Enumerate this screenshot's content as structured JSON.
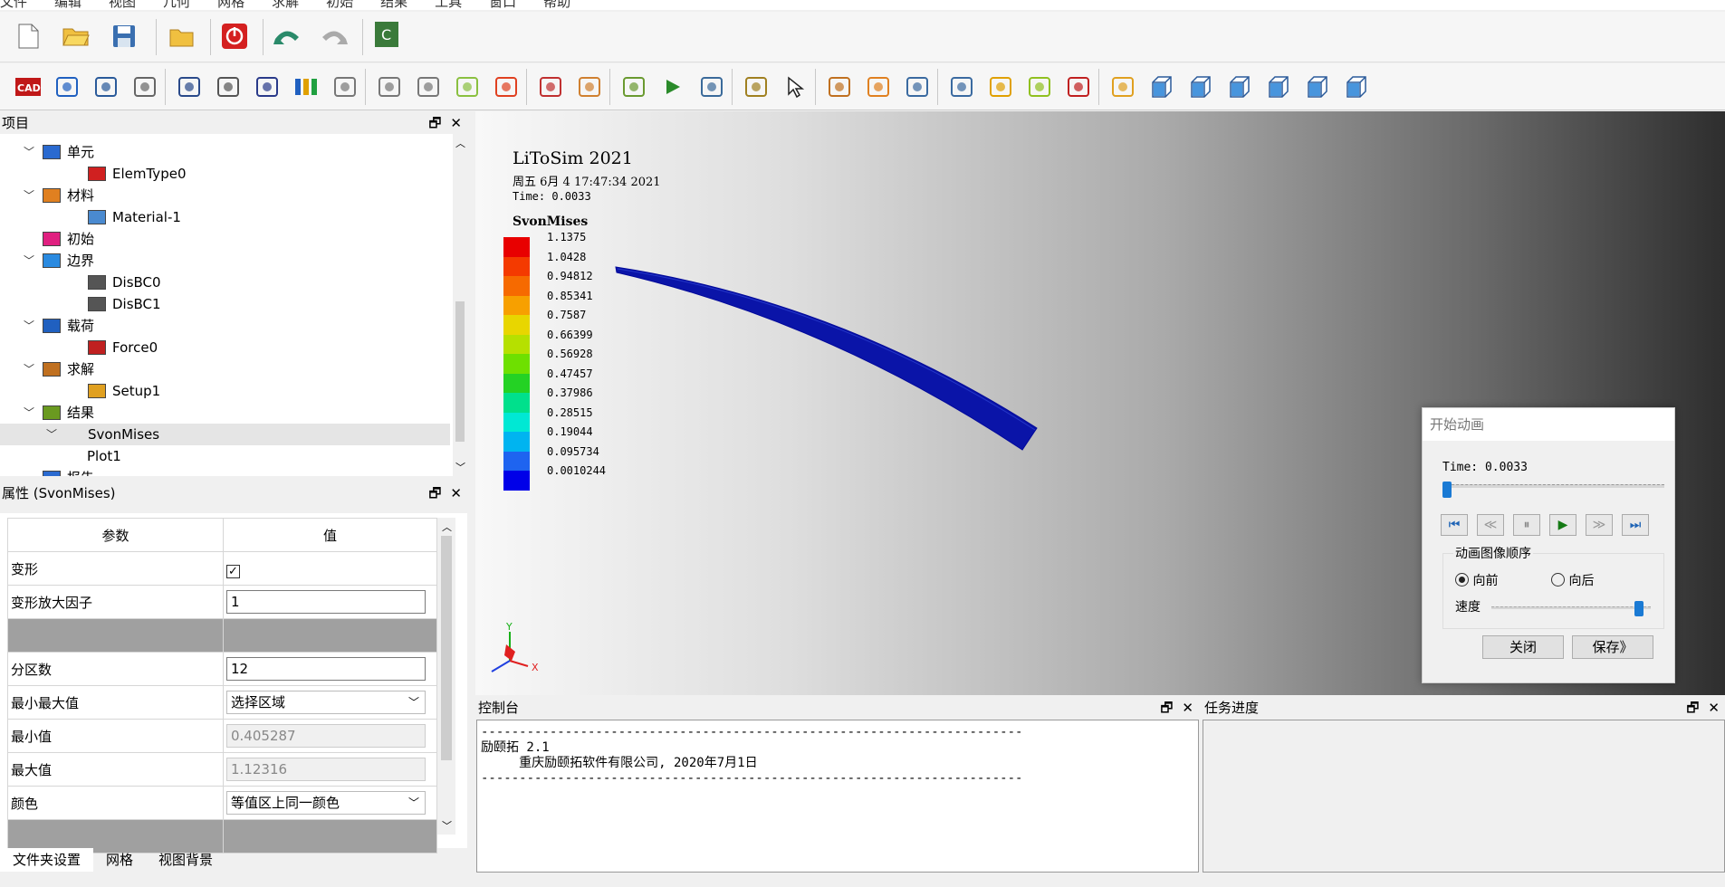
{
  "menu": [
    "文件",
    "编辑",
    "视图",
    "几何",
    "网格",
    "求解",
    "初始",
    "结果",
    "工具",
    "窗口",
    "帮助"
  ],
  "toolbar1": [
    "new-file-icon",
    "open-folder-icon",
    "save-icon",
    "import-icon",
    "power-icon",
    "undo-icon",
    "redo-icon",
    "script-icon"
  ],
  "toolbar2": [
    "cad-import-icon",
    "blocks-icon",
    "box-icon",
    "cylinder-icon",
    "sphere-icon",
    "cone-icon",
    "torus-icon",
    "color-bars-icon",
    "face-icon",
    "extrude-icon",
    "sweep-icon",
    "mesh-cube-icon",
    "mesh-red-cube-icon",
    "mesh-delete-icon",
    "geology-icon",
    "curve-icon",
    "run-icon",
    "zoom-grid-icon",
    "chart-icon",
    "pointer-icon",
    "rotate-icon",
    "pick-icon",
    "zoom-window-icon",
    "zoom-in-icon",
    "add-icon",
    "plus-ball-icon",
    "color-map-icon",
    "bar-chart-icon",
    "view-front-icon",
    "view-back-icon",
    "view-left-icon",
    "view-right-icon",
    "view-top-icon",
    "view-bottom-icon"
  ],
  "project_panel": {
    "title": "项目"
  },
  "tree": [
    {
      "label": "单元",
      "level": 0,
      "arrow": true,
      "icon": "element-icon"
    },
    {
      "label": "ElemType0",
      "level": 1,
      "arrow": false,
      "icon": "elemtype-icon"
    },
    {
      "label": "材料",
      "level": 0,
      "arrow": true,
      "icon": "material-icon"
    },
    {
      "label": "Material-1",
      "level": 1,
      "arrow": false,
      "icon": "material-item-icon"
    },
    {
      "label": "初始",
      "level": 0,
      "arrow": false,
      "icon": "initial-icon"
    },
    {
      "label": "边界",
      "level": 0,
      "arrow": true,
      "icon": "boundary-icon"
    },
    {
      "label": "DisBC0",
      "level": 1,
      "arrow": false,
      "icon": "disbc-icon"
    },
    {
      "label": "DisBC1",
      "level": 1,
      "arrow": false,
      "icon": "disbc-icon"
    },
    {
      "label": "载荷",
      "level": 0,
      "arrow": true,
      "icon": "load-icon"
    },
    {
      "label": "Force0",
      "level": 1,
      "arrow": false,
      "icon": "force-icon"
    },
    {
      "label": "求解",
      "level": 0,
      "arrow": true,
      "icon": "solve-icon"
    },
    {
      "label": "Setup1",
      "level": 1,
      "arrow": false,
      "icon": "setup-icon"
    },
    {
      "label": "结果",
      "level": 0,
      "arrow": true,
      "icon": "result-icon"
    },
    {
      "label": "SvonMises",
      "level": 1,
      "arrow": true,
      "icon": "",
      "selected": true
    },
    {
      "label": "Plot1",
      "level": 2,
      "arrow": false,
      "icon": ""
    },
    {
      "label": "报告",
      "level": 0,
      "arrow": false,
      "icon": "report-icon"
    }
  ],
  "props_panel": {
    "title": "属性 (SvonMises)"
  },
  "props": {
    "header_param": "参数",
    "header_value": "值",
    "deform_label": "变形",
    "deform_checked": "✓",
    "factor_label": "变形放大因子",
    "factor_value": "1",
    "divisions_label": "分区数",
    "divisions_value": "12",
    "minmax_label": "最小最大值",
    "minmax_value": "选择区域",
    "min_label": "最小值",
    "min_value": "0.405287",
    "max_label": "最大值",
    "max_value": "1.12316",
    "color_label": "颜色",
    "color_value": "等值区上同一颜色"
  },
  "bottom_tabs": [
    "文件夹设置",
    "网格",
    "视图背景"
  ],
  "viewport": {
    "app_title": "LiToSim 2021",
    "datetime": "周五 6月 4 17:47:34 2021",
    "time_label": "Time:  0.0033",
    "legend_title": "SvonMises",
    "legend_values": [
      "1.1375",
      "1.0428",
      "0.94812",
      "0.85341",
      "0.7587",
      "0.66399",
      "0.56928",
      "0.47457",
      "0.37986",
      "0.28515",
      "0.19044",
      "0.095734",
      "0.0010244"
    ],
    "legend_colors": [
      "#e80000",
      "#f43a00",
      "#f66a00",
      "#f7a000",
      "#e8d600",
      "#b6e000",
      "#6ee000",
      "#24d224",
      "#00e08c",
      "#00e8d4",
      "#00b4f0",
      "#1e64f0",
      "#0000e8"
    ],
    "axis_x": "X",
    "axis_y": "Y"
  },
  "console": {
    "title": "控制台",
    "lines": [
      "-----------------------------------------------------------------------",
      "励颐拓 2.1",
      "     重庆励颐拓软件有限公司, 2020年7月1日",
      "-----------------------------------------------------------------------"
    ]
  },
  "task": {
    "title": "任务进度"
  },
  "animation_dialog": {
    "title": "开始动画",
    "time_label": "Time: 0.0033",
    "order_label": "动画图像顺序",
    "forward_label": "向前",
    "backward_label": "向后",
    "speed_label": "速度",
    "close_label": "关闭",
    "save_label": "保存》",
    "direction": "forward",
    "time_fraction": 0.0,
    "speed_fraction": 0.95
  }
}
